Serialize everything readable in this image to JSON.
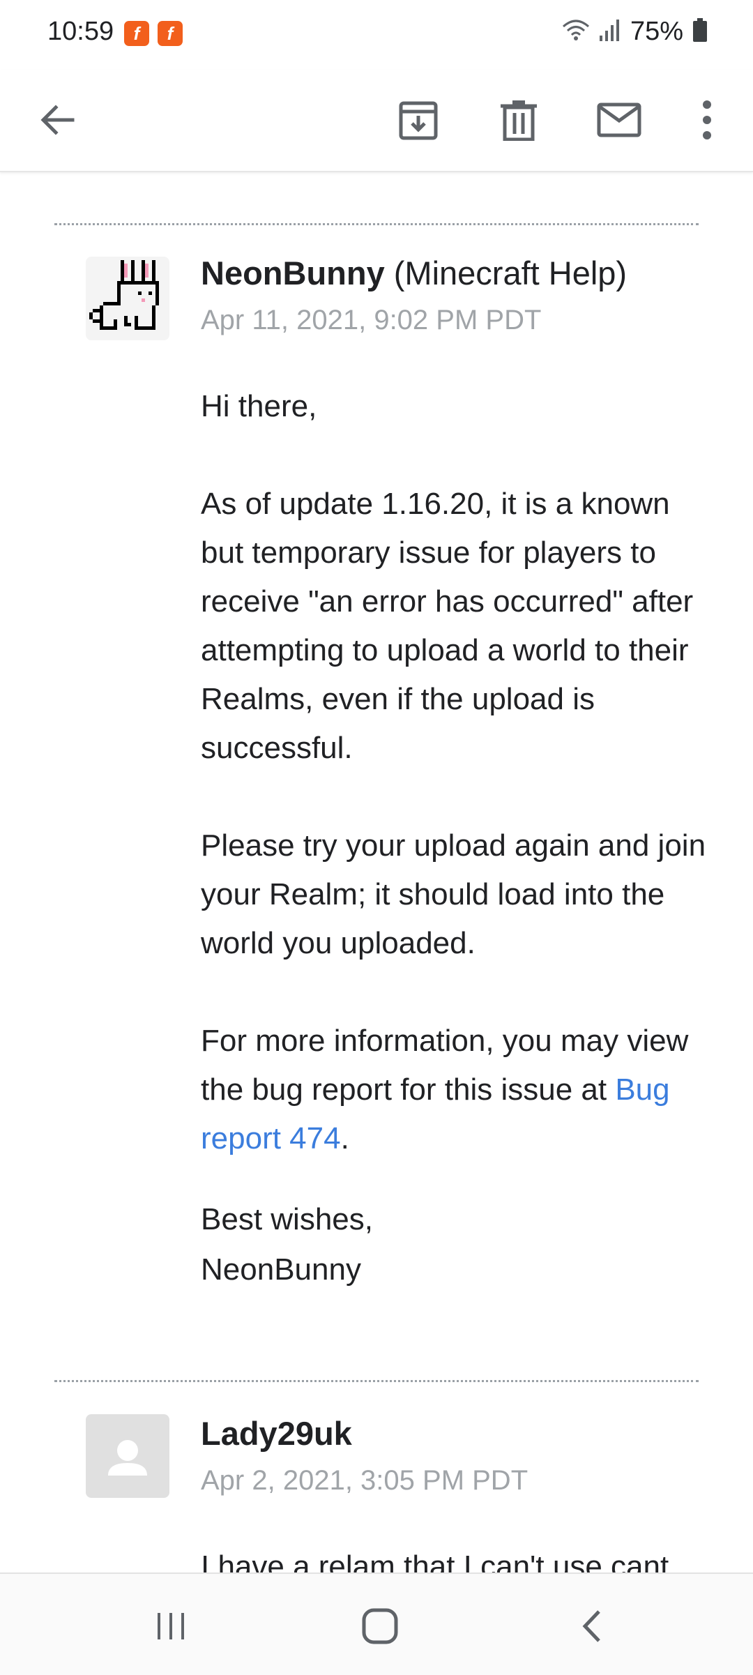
{
  "status_bar": {
    "time": "10:59",
    "notification_icons": [
      "flipboard-icon",
      "flipboard-icon"
    ],
    "battery": "75%"
  },
  "toolbar": {
    "icons": [
      "back-arrow-icon",
      "archive-icon",
      "delete-icon",
      "mark-unread-icon",
      "more-options-icon"
    ]
  },
  "messages": [
    {
      "sender": "NeonBunny",
      "group": "(Minecraft Help)",
      "date": "Apr 11, 2021, 9:02 PM PDT",
      "avatar": "pixel-bunny-avatar",
      "greeting": "Hi there,",
      "p1": "As of update 1.16.20, it is a known but temporary issue for players to receive \"an error has occurred\" after attempting to upload a world to their Realms, even if the upload is successful.",
      "p2": "Please try your upload again and join your Realm; it should load into the world you uploaded.",
      "p3_prefix": "For more information, you may view the bug report for this issue at ",
      "p3_link": "Bug report 474",
      "p3_suffix": ".",
      "signoff_line1": "Best wishes,",
      "signoff_line2": "NeonBunny"
    },
    {
      "sender": "Lady29uk",
      "date": "Apr 2, 2021, 3:05 PM PDT",
      "avatar": "default-person-avatar",
      "body_preview": "I have a relam that I can't use cant"
    }
  ],
  "nav_bar": {
    "icons": [
      "recent-apps-icon",
      "home-icon",
      "back-icon"
    ]
  },
  "colors": {
    "link": "#3b7ddd",
    "date_text": "#a0a4a8",
    "notification_badge": "#f25f1c"
  }
}
